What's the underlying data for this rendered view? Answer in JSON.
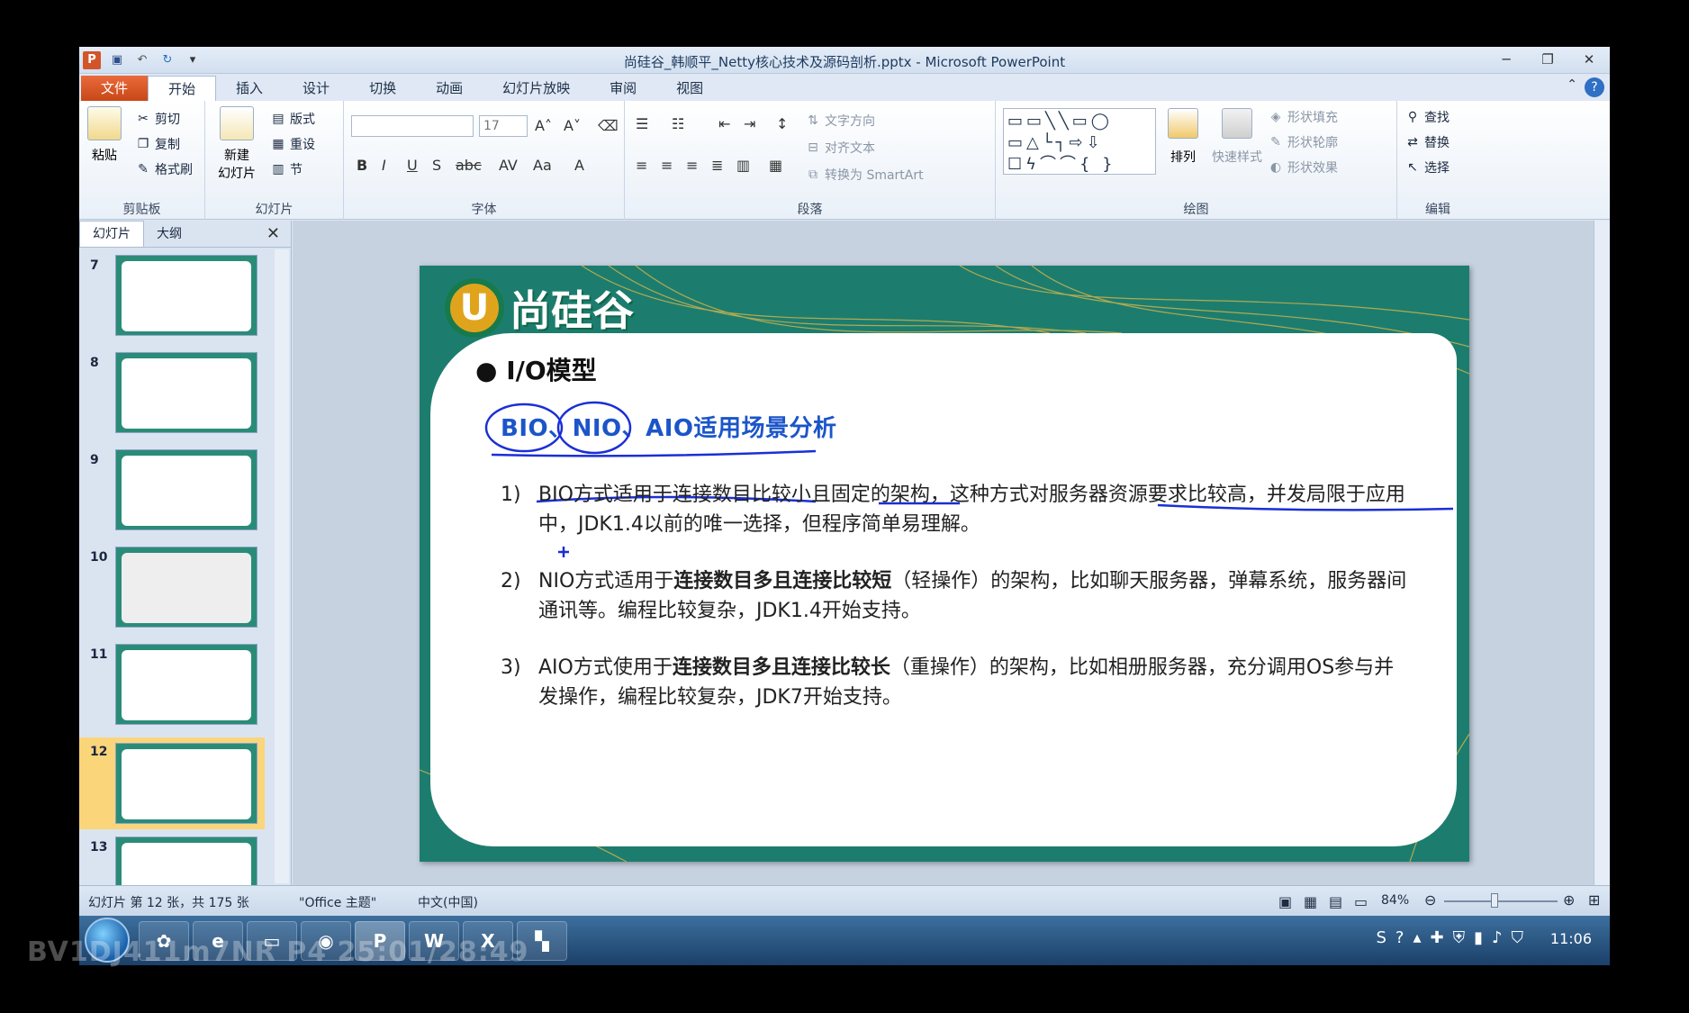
{
  "window": {
    "title": "尚硅谷_韩顺平_Netty核心技术及源码剖析.pptx - Microsoft PowerPoint",
    "minimize": "─",
    "restore": "❐",
    "close": "✕"
  },
  "ribbon_tabs": [
    "文件",
    "开始",
    "插入",
    "设计",
    "切换",
    "动画",
    "幻灯片放映",
    "审阅",
    "视图"
  ],
  "ribbon": {
    "clipboard": {
      "label": "剪贴板",
      "paste": "粘贴",
      "cut": "剪切",
      "copy": "复制",
      "format_painter": "格式刷"
    },
    "slides": {
      "label": "幻灯片",
      "new_slide": "新建",
      "new_slide2": "幻灯片",
      "layout": "版式",
      "reset": "重设",
      "section": "节"
    },
    "font": {
      "label": "字体",
      "font_name": "",
      "font_size": "17"
    },
    "paragraph": {
      "label": "段落",
      "text_direction": "文字方向",
      "align_text": "对齐文本",
      "convert_smartart": "转换为 SmartArt"
    },
    "drawing": {
      "label": "绘图",
      "arrange": "排列",
      "quick_styles": "快速样式",
      "shape_fill": "形状填充",
      "shape_outline": "形状轮廓",
      "shape_effects": "形状效果"
    },
    "editing": {
      "label": "编辑",
      "find": "查找",
      "replace": "替换",
      "select": "选择"
    }
  },
  "slide_panel": {
    "tabs": [
      "幻灯片",
      "大纲"
    ],
    "thumbnails": [
      "7",
      "8",
      "9",
      "10",
      "11",
      "12",
      "13"
    ],
    "selected": "12"
  },
  "slide": {
    "logo_text": "尚硅谷",
    "logo_letter": "U",
    "title": "I/O模型",
    "subtitle": "BIO、NIO、AIO适用场景分析",
    "items": [
      {
        "num": "1)",
        "text": "BIO方式适用于连接数目比较小且固定的架构，这种方式对服务器资源要求比较高，并发局限于应用中，JDK1.4以前的唯一选择，但程序简单易理解。"
      },
      {
        "num": "2)",
        "text_a": "NIO方式适用于",
        "bold": "连接数目多且连接比较短",
        "text_b": "（轻操作）的架构，比如聊天服务器，弹幕系统，服务器间通讯等。编程比较复杂，JDK1.4开始支持。"
      },
      {
        "num": "3)",
        "text_a": "AIO方式使用于",
        "bold": "连接数目多且连接比较长",
        "text_b": "（重操作）的架构，比如相册服务器，充分调用OS参与并发操作，编程比较复杂，JDK7开始支持。"
      }
    ]
  },
  "status": {
    "slide_info": "幻灯片 第 12 张，共 175 张",
    "theme": "\"Office 主题\"",
    "language": "中文(中国)",
    "zoom": "84%"
  },
  "taskbar": {
    "clock": "11:06"
  },
  "watermark": "BV1DJ411m7NR P4 25:01/28:49",
  "colors": {
    "file_tab": "#d2552a",
    "slide_bg": "#1c7d6e",
    "subtitle": "#1b55c9",
    "selected_thumb": "#fbd57a"
  }
}
